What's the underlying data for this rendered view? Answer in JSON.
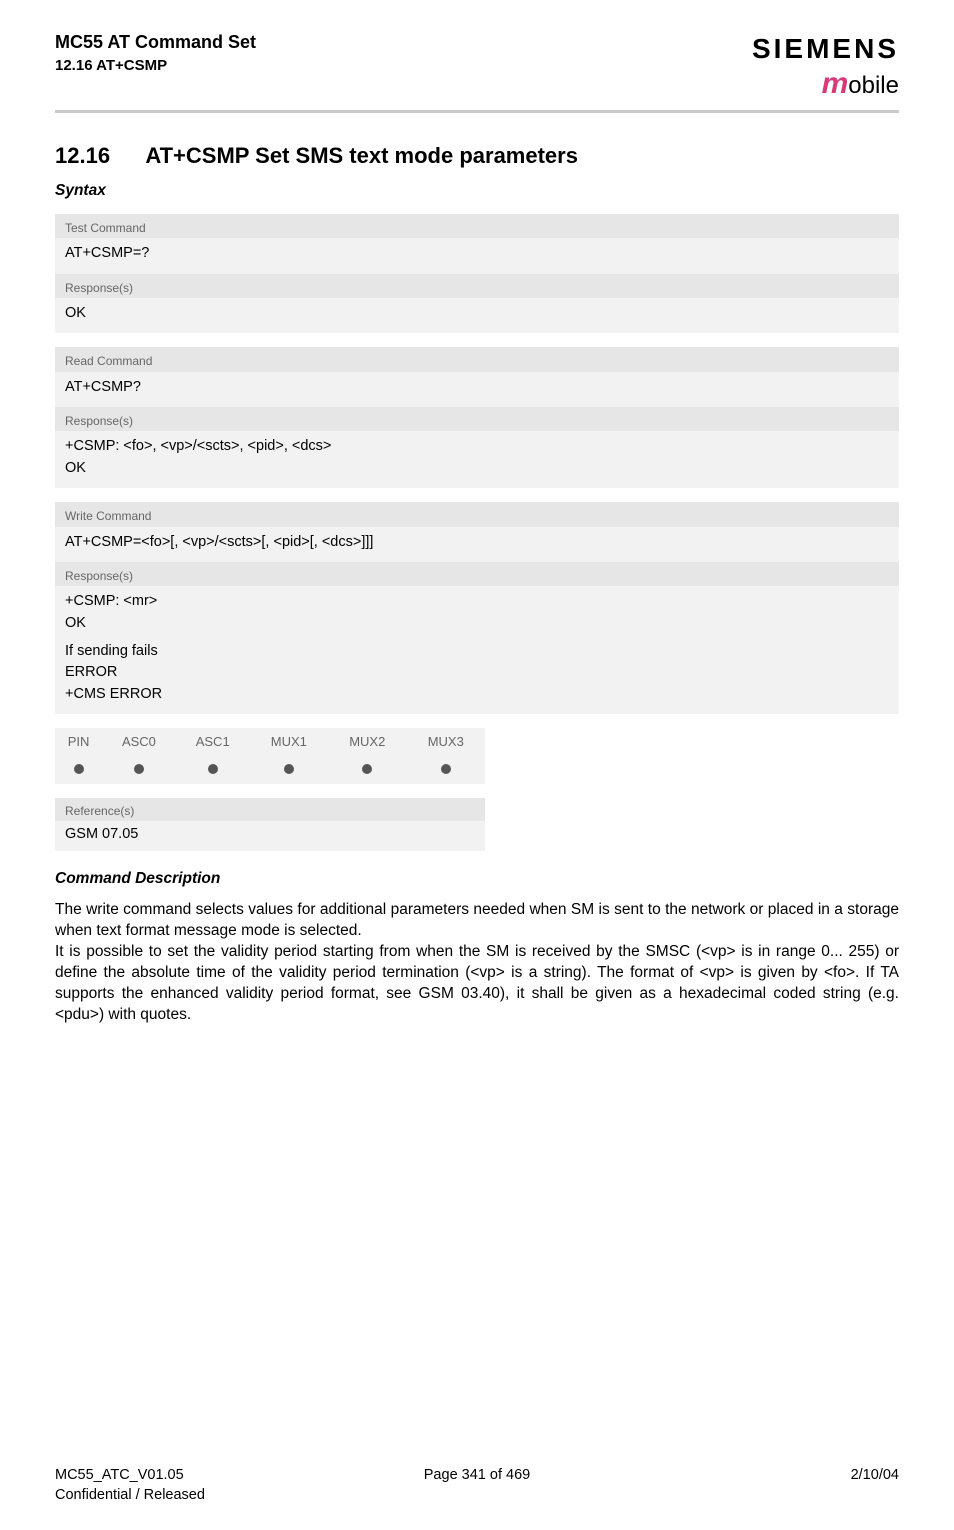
{
  "header": {
    "title": "MC55 AT Command Set",
    "subtitle": "12.16 AT+CSMP",
    "brand_main": "SIEMENS",
    "brand_m": "m",
    "brand_rest": "obile"
  },
  "section": {
    "number": "12.16",
    "title": "AT+CSMP   Set SMS text mode parameters",
    "syntax_heading": "Syntax"
  },
  "test_cmd": {
    "header": "Test Command",
    "line1": "AT+CSMP=?"
  },
  "test_resp": {
    "header": "Response(s)",
    "line1": "OK"
  },
  "read_cmd": {
    "header": "Read Command",
    "line1": "AT+CSMP?"
  },
  "read_resp": {
    "header": "Response(s)",
    "line1": "+CSMP: <fo>, <vp>/<scts>, <pid>, <dcs>",
    "line2": "OK"
  },
  "write_cmd": {
    "header": "Write Command",
    "line1": "AT+CSMP=<fo>[, <vp>/<scts>[, <pid>[, <dcs>]]]"
  },
  "write_resp": {
    "header": "Response(s)",
    "line1": "+CSMP: <mr>",
    "line2": "OK",
    "fail_label": "If sending fails",
    "fail_line1": "ERROR",
    "fail_line2": "+CMS ERROR"
  },
  "support_table": {
    "headers": [
      "PIN",
      "ASC0",
      "ASC1",
      "MUX1",
      "MUX2",
      "MUX3"
    ]
  },
  "reference": {
    "header": "Reference(s)",
    "body": "GSM 07.05"
  },
  "description": {
    "heading": "Command Description",
    "p1": "The write command selects values for additional parameters needed when SM is sent to the network or placed in a storage when text format message mode is selected.",
    "p2": "It is possible to set the validity period starting from when the SM is received by the SMSC (<vp> is in range 0... 255) or define the absolute time of the validity period termination (<vp> is a string). The format of <vp> is given by <fo>. If TA supports the enhanced validity period format, see GSM 03.40), it shall be given as a hexadecimal coded string (e.g. <pdu>) with quotes."
  },
  "footer": {
    "left1": "MC55_ATC_V01.05",
    "left2": "Confidential / Released",
    "center": "Page 341 of 469",
    "right": "2/10/04"
  }
}
